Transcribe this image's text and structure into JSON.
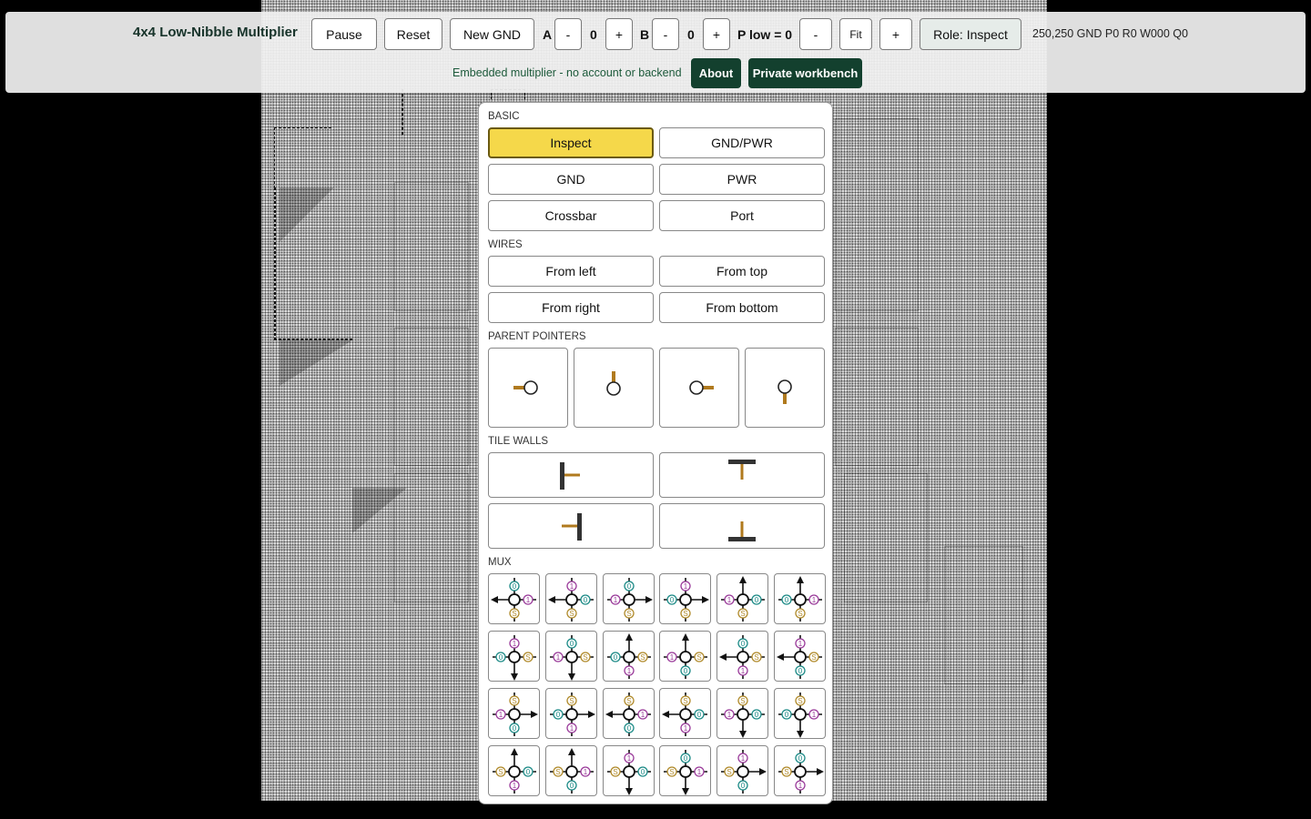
{
  "app": {
    "title": "4x4 Low-Nibble Multiplier"
  },
  "toolbar": {
    "pause": "Pause",
    "reset": "Reset",
    "new_gnd": "New GND",
    "a_label": "A",
    "a_value": "0",
    "b_label": "B",
    "b_value": "0",
    "minus": "-",
    "plus": "+",
    "p_low": "P low = 0",
    "fit": "Fit",
    "role": "Role: Inspect",
    "status": "250,250 GND P0 R0 W000 Q0",
    "embed_note": "Embedded multiplier - no account or backend",
    "about": "About",
    "workbench": "Private workbench"
  },
  "palette": {
    "basic_heading": "BASIC",
    "basic": [
      "Inspect",
      "GND/PWR",
      "GND",
      "PWR",
      "Crossbar",
      "Port"
    ],
    "selected": "Inspect",
    "wires_heading": "WIRES",
    "wires": [
      "From left",
      "From top",
      "From right",
      "From bottom"
    ],
    "parent_heading": "PARENT POINTERS",
    "parent_pointers": [
      "left-pointer-icon",
      "top-pointer-icon",
      "right-pointer-icon",
      "bottom-pointer-icon"
    ],
    "walls_heading": "TILE WALLS",
    "tile_walls": [
      "left-wall-icon",
      "top-wall-icon",
      "right-wall-icon",
      "bottom-wall-icon"
    ],
    "mux_heading": "MUX",
    "mux": [
      {
        "out": "W",
        "N": "0",
        "E": "1",
        "S": "S",
        "W": ""
      },
      {
        "out": "W",
        "N": "1",
        "E": "0",
        "S": "S",
        "W": ""
      },
      {
        "out": "E",
        "N": "0",
        "E": "",
        "S": "S",
        "W": "1"
      },
      {
        "out": "E",
        "N": "1",
        "E": "",
        "S": "S",
        "W": "0"
      },
      {
        "out": "N",
        "N": "",
        "E": "0",
        "S": "S",
        "W": "1"
      },
      {
        "out": "N",
        "N": "",
        "E": "1",
        "S": "S",
        "W": "0"
      },
      {
        "out": "S",
        "N": "1",
        "E": "S",
        "S": "",
        "W": "0"
      },
      {
        "out": "S",
        "N": "0",
        "E": "S",
        "S": "",
        "W": "1"
      },
      {
        "out": "N",
        "N": "",
        "E": "S",
        "S": "1",
        "W": "0"
      },
      {
        "out": "N",
        "N": "",
        "E": "S",
        "S": "0",
        "W": "1"
      },
      {
        "out": "W",
        "N": "0",
        "E": "S",
        "S": "1",
        "W": ""
      },
      {
        "out": "W",
        "N": "1",
        "E": "S",
        "S": "0",
        "W": ""
      },
      {
        "out": "E",
        "N": "S",
        "E": "",
        "S": "0",
        "W": "1"
      },
      {
        "out": "E",
        "N": "S",
        "E": "",
        "S": "1",
        "W": "0"
      },
      {
        "out": "W",
        "N": "S",
        "E": "1",
        "S": "0",
        "W": ""
      },
      {
        "out": "W",
        "N": "S",
        "E": "0",
        "S": "1",
        "W": ""
      },
      {
        "out": "S",
        "N": "S",
        "E": "0",
        "S": "",
        "W": "1"
      },
      {
        "out": "S",
        "N": "S",
        "E": "1",
        "S": "",
        "W": "0"
      },
      {
        "out": "N",
        "N": "",
        "E": "0",
        "S": "1",
        "W": "S"
      },
      {
        "out": "N",
        "N": "",
        "E": "1",
        "S": "0",
        "W": "S"
      },
      {
        "out": "S",
        "N": "1",
        "E": "0",
        "S": "",
        "W": "S"
      },
      {
        "out": "S",
        "N": "0",
        "E": "1",
        "S": "",
        "W": "S"
      },
      {
        "out": "E",
        "N": "1",
        "E": "",
        "S": "0",
        "W": "S"
      },
      {
        "out": "E",
        "N": "0",
        "E": "",
        "S": "1",
        "W": "S"
      }
    ]
  },
  "colors": {
    "accent_dark": "#13402e",
    "selected": "#f5d84a",
    "pointer": "#b07a1e",
    "mux_zero": "#1b8a86",
    "mux_one": "#9a3a9a",
    "mux_select": "#b08a2a"
  }
}
